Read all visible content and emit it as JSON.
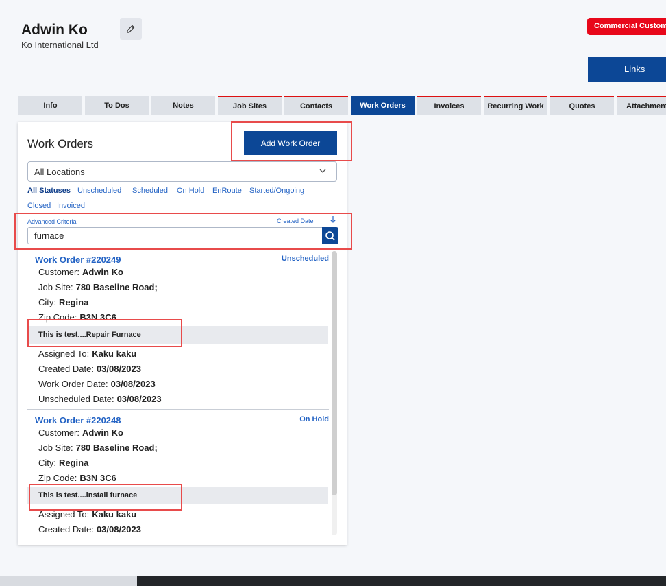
{
  "header": {
    "customer_name": "Adwin Ko",
    "company": "Ko International Ltd",
    "customer_type": "Commercial Customer",
    "links_label": "Links"
  },
  "tabs": [
    {
      "label": "Info"
    },
    {
      "label": "To Dos"
    },
    {
      "label": "Notes"
    },
    {
      "label": "Job Sites"
    },
    {
      "label": "Contacts"
    },
    {
      "label": "Work Orders"
    },
    {
      "label": "Invoices"
    },
    {
      "label": "Recurring Work"
    },
    {
      "label": "Quotes"
    },
    {
      "label": "Attachments"
    }
  ],
  "active_tab": "Work Orders",
  "panel": {
    "title": "Work Orders",
    "add_button": "Add Work Order",
    "location": "All Locations",
    "statuses": [
      "All Statuses",
      "Unscheduled",
      "Scheduled",
      "On Hold",
      "EnRoute",
      "Started/Ongoing",
      "Closed",
      "Invoiced"
    ],
    "advanced_criteria": "Advanced Criteria",
    "sort_label": "Created Date",
    "search_value": "furnace"
  },
  "labels": {
    "customer": "Customer:",
    "job_site": "Job Site:",
    "city": "City:",
    "zip": "Zip Code:",
    "assigned": "Assigned To:",
    "created": "Created Date:",
    "wo_date": "Work Order Date:",
    "unscheduled_date": "Unscheduled Date:"
  },
  "work_orders": [
    {
      "title": "Work Order #220249",
      "status": "Unscheduled",
      "customer": "Adwin Ko",
      "job_site": "780 Baseline Road;",
      "city": "Regina",
      "zip": "B3N 3C6",
      "description": "This is test....Repair Furnace",
      "assigned": "Kaku kaku",
      "created": "03/08/2023",
      "wo_date": "03/08/2023",
      "unscheduled_date": "03/08/2023"
    },
    {
      "title": "Work Order #220248",
      "status": "On Hold",
      "customer": "Adwin Ko",
      "job_site": "780 Baseline Road;",
      "city": "Regina",
      "zip": "B3N 3C6",
      "description": "This is test....install furnace",
      "assigned": "Kaku kaku",
      "created": "03/08/2023"
    }
  ],
  "colors": {
    "primary": "#0c4796",
    "link": "#2262c4",
    "badge": "#e8081a",
    "highlight": "#e84b4b"
  }
}
